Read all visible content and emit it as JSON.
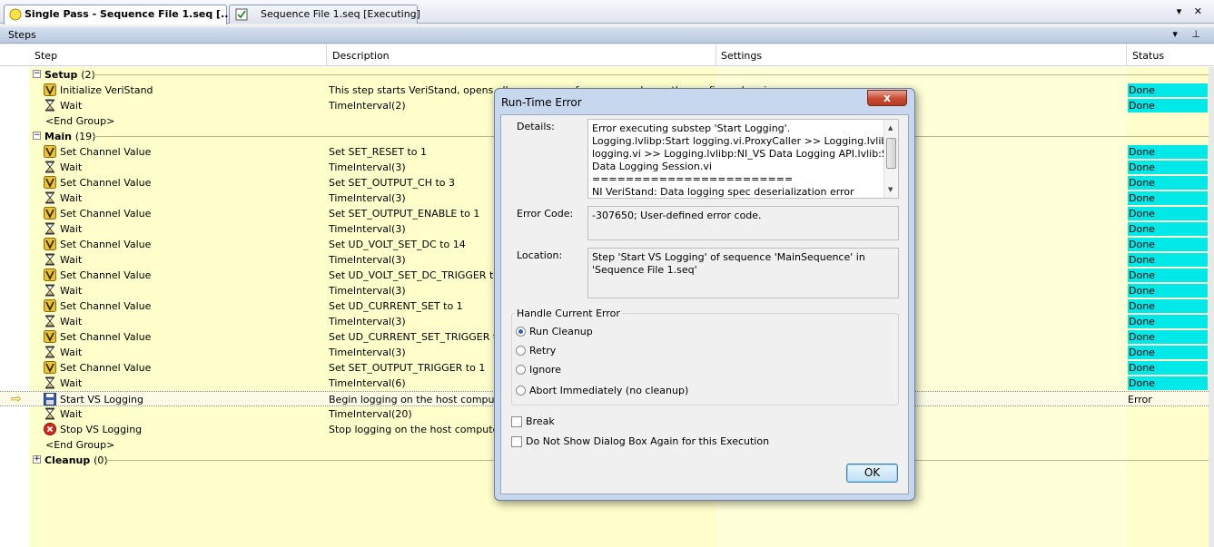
{
  "tabs": [
    {
      "label": "Single Pass - Sequence File 1.seq [..."
    },
    {
      "label": "Sequence File 1.seq [Executing]"
    }
  ],
  "tab_controls": "▾ ✕",
  "steps_panel": {
    "title": "Steps",
    "controls": "▾ ⊥"
  },
  "columns": {
    "step": "Step",
    "description": "Description",
    "settings": "Settings",
    "status": "Status"
  },
  "groups": {
    "setup": {
      "name": "Setup",
      "count": "(2)",
      "toggle": "−"
    },
    "main": {
      "name": "Main",
      "count": "(19)",
      "toggle": "−"
    },
    "cleanup": {
      "name": "Cleanup",
      "count": "(0)",
      "toggle": "+"
    }
  },
  "end_group": "<End Group>",
  "setup_steps": [
    {
      "name": "Initialize VeriStand",
      "description": "This step starts VeriStand, opens all necessary references, and runs the configured proj",
      "status": "Done",
      "icon": "veristand-icon"
    },
    {
      "name": "Wait",
      "description": "TimeInterval(2)",
      "status": "Done",
      "icon": "hourglass-icon"
    }
  ],
  "main_steps": [
    {
      "name": "Set Channel Value",
      "description": "Set SET_RESET to 1",
      "status": "Done",
      "icon": "veristand-icon"
    },
    {
      "name": "Wait",
      "description": "TimeInterval(3)",
      "status": "Done",
      "icon": "hourglass-icon"
    },
    {
      "name": "Set Channel Value",
      "description": "Set SET_OUTPUT_CH to 3",
      "status": "Done",
      "icon": "veristand-icon"
    },
    {
      "name": "Wait",
      "description": "TimeInterval(3)",
      "status": "Done",
      "icon": "hourglass-icon"
    },
    {
      "name": "Set Channel Value",
      "description": "Set SET_OUTPUT_ENABLE to 1",
      "status": "Done",
      "icon": "veristand-icon"
    },
    {
      "name": "Wait",
      "description": "TimeInterval(3)",
      "status": "Done",
      "icon": "hourglass-icon"
    },
    {
      "name": "Set Channel Value",
      "description": "Set UD_VOLT_SET_DC to 14",
      "status": "Done",
      "icon": "veristand-icon"
    },
    {
      "name": "Wait",
      "description": "TimeInterval(3)",
      "status": "Done",
      "icon": "hourglass-icon"
    },
    {
      "name": "Set Channel Value",
      "description": "Set UD_VOLT_SET_DC_TRIGGER to 1",
      "status": "Done",
      "icon": "veristand-icon"
    },
    {
      "name": "Wait",
      "description": "TimeInterval(3)",
      "status": "Done",
      "icon": "hourglass-icon"
    },
    {
      "name": "Set Channel Value",
      "description": "Set UD_CURRENT_SET to 1",
      "status": "Done",
      "icon": "veristand-icon"
    },
    {
      "name": "Wait",
      "description": "TimeInterval(3)",
      "status": "Done",
      "icon": "hourglass-icon"
    },
    {
      "name": "Set Channel Value",
      "description": "Set UD_CURRENT_SET_TRIGGER to 1",
      "status": "Done",
      "icon": "veristand-icon"
    },
    {
      "name": "Wait",
      "description": "TimeInterval(3)",
      "status": "Done",
      "icon": "hourglass-icon"
    },
    {
      "name": "Set Channel Value",
      "description": "Set SET_OUTPUT_TRIGGER to 1",
      "status": "Done",
      "icon": "veristand-icon"
    },
    {
      "name": "Wait",
      "description": "TimeInterval(6)",
      "status": "Done",
      "icon": "hourglass-icon"
    },
    {
      "name": "Start VS Logging",
      "description": "Begin logging on the host computer",
      "status": "Error",
      "icon": "save-icon",
      "current": true
    },
    {
      "name": "Wait",
      "description": "TimeInterval(20)",
      "status": "",
      "icon": "hourglass-icon"
    },
    {
      "name": "Stop VS Logging",
      "description": "Stop logging on the host computer",
      "status": "",
      "icon": "stop-icon"
    }
  ],
  "dialog": {
    "title": "Run-Time Error",
    "close_label": "x",
    "details_label": "Details:",
    "details_lines": [
      "Error executing substep 'Start Logging'.",
      "Logging.lvlibp:Start logging.vi.ProxyCaller >> Logging.lvlibp:Start",
      "logging.vi >> Logging.lvlibp:NI_VS Data Logging API.lvlib:Start",
      "Data Logging Session.vi",
      "========================",
      "NI VeriStand:  Data logging spec deserialization error"
    ],
    "error_code_label": "Error Code:",
    "error_code": "-307650; User-defined error code.",
    "location_label": "Location:",
    "location": "Step 'Start VS Logging' of sequence 'MainSequence' in 'Sequence File 1.seq'",
    "handle_title": "Handle Current Error",
    "options": [
      "Run Cleanup",
      "Retry",
      "Ignore",
      "Abort Immediately (no cleanup)"
    ],
    "selected_option": "Run Cleanup",
    "break_label": "Break",
    "no_show_label": "Do Not Show Dialog Box Again for this Execution",
    "ok_label": "OK"
  },
  "colors": {
    "done": "#00e8e8",
    "row_bg": "#ffffcc"
  }
}
